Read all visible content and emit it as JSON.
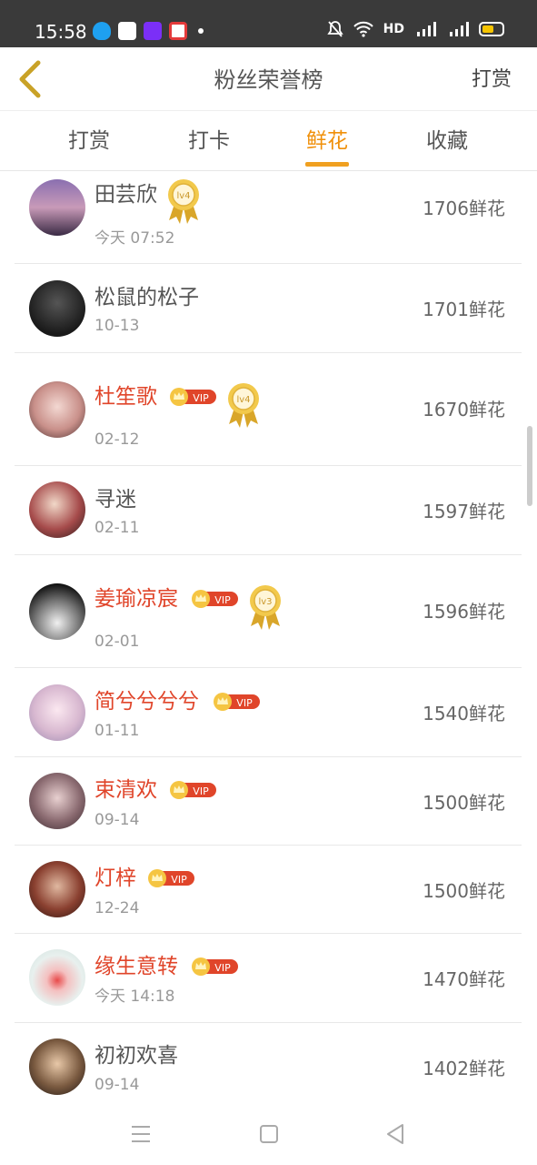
{
  "status_bar": {
    "time": "15:58",
    "network_label": "HD"
  },
  "header": {
    "title": "粉丝荣誉榜",
    "action_label": "打赏",
    "back_icon": "chevron-left-icon",
    "accent": "#f0a020"
  },
  "tabs": [
    {
      "label": "打赏",
      "active": false
    },
    {
      "label": "打卡",
      "active": false
    },
    {
      "label": "鲜花",
      "active": true
    },
    {
      "label": "收藏",
      "active": false
    }
  ],
  "rows": [
    {
      "name": "田芸欣",
      "date": "今天 07:52",
      "count": "1706鲜花",
      "vip": false,
      "medal": "lv4"
    },
    {
      "name": "松鼠的松子",
      "date": "10-13",
      "count": "1701鲜花",
      "vip": false,
      "medal": ""
    },
    {
      "name": "杜笙歌",
      "date": "02-12",
      "count": "1670鲜花",
      "vip": true,
      "medal": "lv4"
    },
    {
      "name": "寻迷",
      "date": "02-11",
      "count": "1597鲜花",
      "vip": false,
      "medal": ""
    },
    {
      "name": "姜瑜凉宸",
      "date": "02-01",
      "count": "1596鲜花",
      "vip": true,
      "medal": "lv3"
    },
    {
      "name": "简兮兮兮兮",
      "date": "01-11",
      "count": "1540鲜花",
      "vip": true,
      "medal": ""
    },
    {
      "name": "束清欢",
      "date": "09-14",
      "count": "1500鲜花",
      "vip": true,
      "medal": ""
    },
    {
      "name": "灯梓",
      "date": "12-24",
      "count": "1500鲜花",
      "vip": true,
      "medal": ""
    },
    {
      "name": "缘生意转",
      "date": "今天 14:18",
      "count": "1470鲜花",
      "vip": true,
      "medal": ""
    },
    {
      "name": "初初欢喜",
      "date": "09-14",
      "count": "1402鲜花",
      "vip": false,
      "medal": ""
    }
  ],
  "vip_label": "VIP",
  "colors": {
    "vip_name": "#e0452a",
    "accent": "#f0a020",
    "normal_name": "#555555"
  },
  "bottom_nav": [
    "menu-icon",
    "home-square-icon",
    "back-triangle-icon"
  ]
}
